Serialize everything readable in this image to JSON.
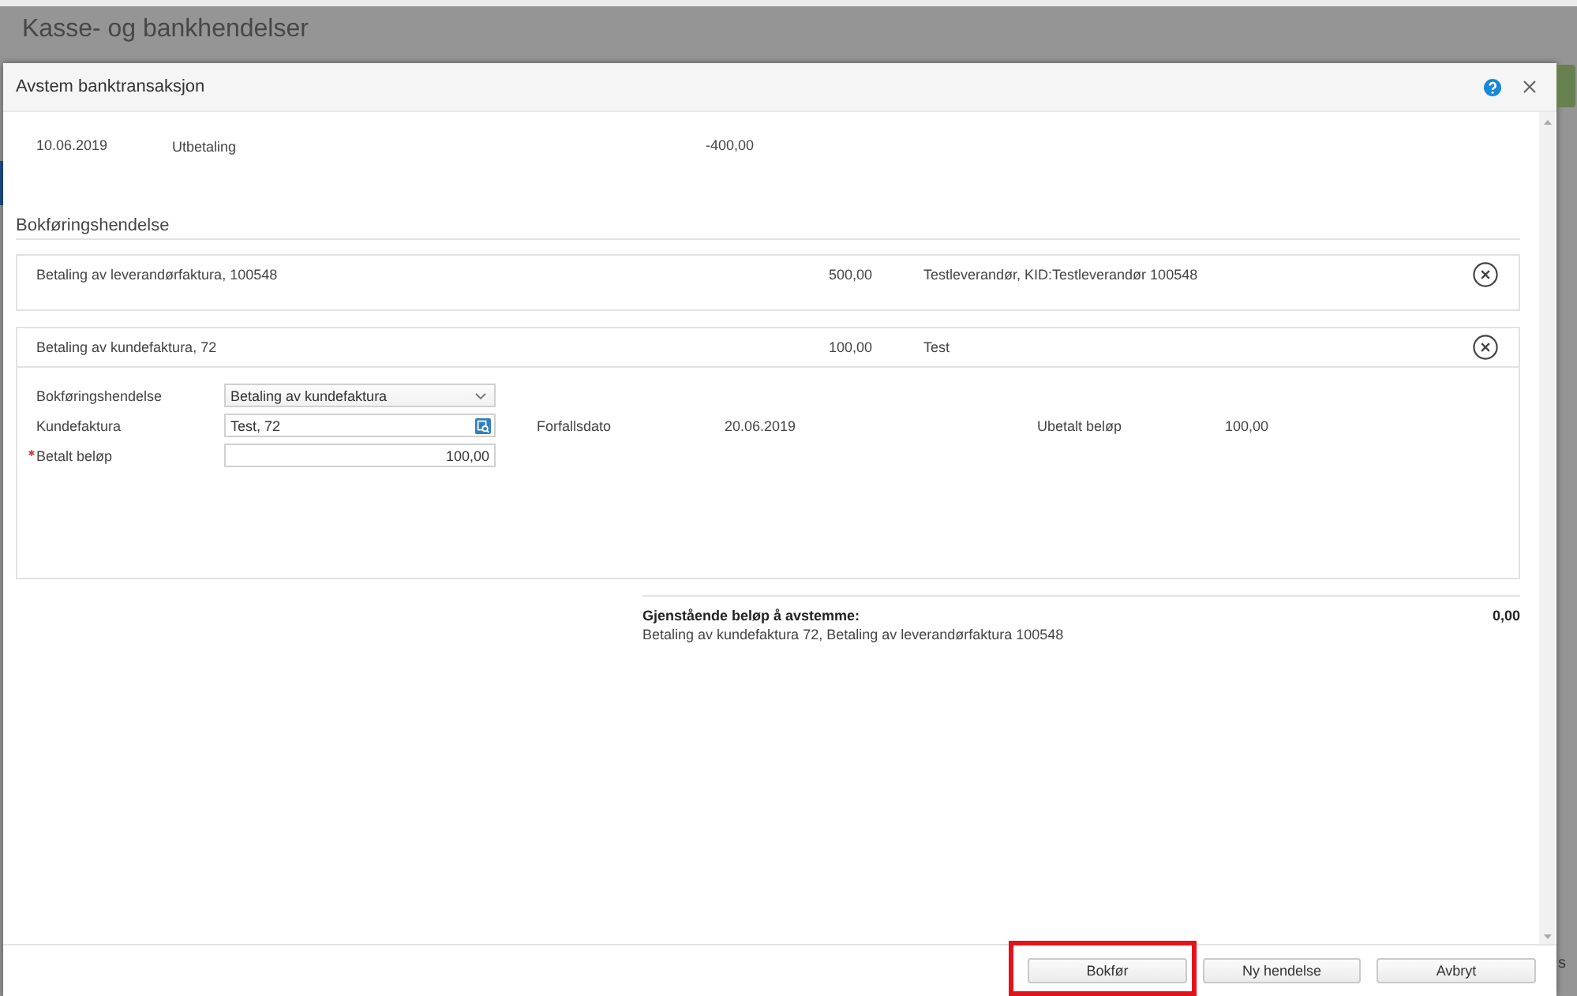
{
  "underlying_page": {
    "title": "Kasse- og bankhendelser",
    "edge_text": "s"
  },
  "dialog": {
    "title": "Avstem banktransaksjon"
  },
  "transaction": {
    "date": "10.06.2019",
    "type": "Utbetaling",
    "amount": "-400,00"
  },
  "section_title": "Bokføringshendelse",
  "events": [
    {
      "title": "Betaling av leverandørfaktura, 100548",
      "amount": "500,00",
      "party": "Testleverandør, KID:Testleverandør 100548",
      "expanded": false
    },
    {
      "title": "Betaling av kundefaktura, 72",
      "amount": "100,00",
      "party": "Test",
      "expanded": true,
      "form": {
        "fields": [
          {
            "label": "Bokføringshendelse",
            "kind": "select",
            "value": "Betaling av kundefaktura",
            "required": false
          },
          {
            "label": "Kundefaktura",
            "kind": "lookup",
            "value": "Test, 72",
            "required": false,
            "info": [
              {
                "label": "Forfallsdato",
                "value": "20.06.2019"
              },
              {
                "label": "Ubetalt beløp",
                "value": "100,00"
              }
            ]
          },
          {
            "label": "Betalt beløp",
            "kind": "number",
            "value": "100,00",
            "required": true
          }
        ]
      }
    }
  ],
  "summary": {
    "label": "Gjenstående beløp å avstemme:",
    "amount": "0,00",
    "details": "Betaling av kundefaktura 72, Betaling av leverandørfaktura 100548"
  },
  "buttons": [
    {
      "label": "Bokfør",
      "highlighted": true
    },
    {
      "label": "Ny hendelse",
      "highlighted": false
    },
    {
      "label": "Avbryt",
      "highlighted": false
    }
  ]
}
